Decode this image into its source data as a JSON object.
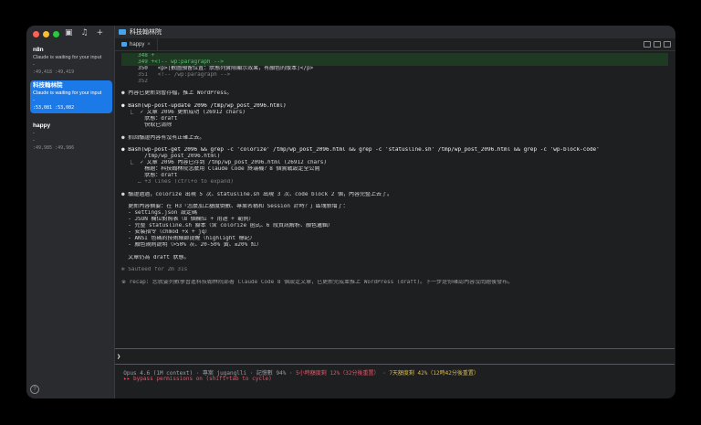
{
  "sidebar": {
    "sessions": [
      {
        "name": "n8n",
        "status": "Claude is waiting for your input",
        "dash": "-",
        "pos": ":49,418 :49,419"
      },
      {
        "name": "科技翰林院",
        "status": "Claude is waiting for your input",
        "dash": "-",
        "pos": ":53,081 :53,082"
      },
      {
        "name": "happy",
        "status": "-",
        "dash": "-",
        "pos": ":49,985 :49,986"
      }
    ],
    "help": "?"
  },
  "window": {
    "title": "科技翰林院"
  },
  "tab": {
    "label": "happy",
    "close": "×"
  },
  "terminal": {
    "lines": [
      {
        "t": "     348 +",
        "c": "diff-add grn"
      },
      {
        "t": "     349 +<!-- wp:paragraph -->",
        "c": "diff-add grn"
      },
      {
        "t": "     350   <p>[數圖預留位置：狀態列實際顯示效果，有顏色的版本]</p>",
        "c": ""
      },
      {
        "t": "     351   <!-- /wp:paragraph -->",
        "c": "dim"
      },
      {
        "t": "     352",
        "c": "dim"
      },
      {
        "t": "",
        "c": ""
      },
      {
        "t": "● 內容已更新到暫存檔，推上 WordPress。",
        "c": ""
      },
      {
        "t": "",
        "c": ""
      },
      {
        "t": "● Bash(wp-post-update 2096 /tmp/wp_post_2096.html)",
        "c": "bash"
      },
      {
        "t": "  ⎿  ✓ 文章 2096 更新成功 (26912 chars)",
        "c": ""
      },
      {
        "t": "       狀態：draft",
        "c": ""
      },
      {
        "t": "       快取已清除",
        "c": ""
      },
      {
        "t": "",
        "c": ""
      },
      {
        "t": "● 抓回驗證內容有沒有正確上去。",
        "c": ""
      },
      {
        "t": "",
        "c": ""
      },
      {
        "t": "● Bash(wp-post-get 2096 && grep -c 'colorize' /tmp/wp_post_2096.html && grep -c 'statusline.sh' /tmp/wp_post_2096.html && grep -c 'wp-block-code'",
        "c": "bash"
      },
      {
        "t": "       /tmp/wp_post_2096.html)",
        "c": ""
      },
      {
        "t": "  ⎿  ✓ 文章 2096 內容已存到 /tmp/wp_post_2096.html (26912 chars)",
        "c": ""
      },
      {
        "t": "       標題：科技翰林院怎麼用 Claude Code 終端機？8 個實戰設定全公開",
        "c": ""
      },
      {
        "t": "       狀態：draft",
        "c": ""
      },
      {
        "t": "     … +3 lines (ctrl+o to expand)",
        "c": "dim"
      },
      {
        "t": "",
        "c": ""
      },
      {
        "t": "● 驗證過過，colorize 出現 5 次、statusline.sh 出現 3 次、code block 2 個，內容完整上去了。",
        "c": "verify"
      },
      {
        "t": "",
        "c": ""
      },
      {
        "t": "  更新內容摘要：在 H3「怎麼加上額度倒數、專案名稱和 Session 計時？」區塊新增了：",
        "c": ""
      },
      {
        "t": "  - settings.json 設定碼",
        "c": "settings"
      },
      {
        "t": "  - JSON 欄位對照表（8 個欄位 + 用途 + 範例）",
        "c": ""
      },
      {
        "t": "  - 完整 statusline.sh 腳本（含 colorize 函式、6 段資訊解析、顏色邏輯）",
        "c": "script"
      },
      {
        "t": "  - 安裝指令（chmod +x + jq）",
        "c": "chmod"
      },
      {
        "t": "  - ANSI 色碼的技術細節提醒（highlight 標記）",
        "c": ""
      },
      {
        "t": "  - 顏色規則說明（>50% 灰、20-50% 黃、≤20% 紅）",
        "c": ""
      },
      {
        "t": "",
        "c": ""
      },
      {
        "t": "  文章仍為 draft 狀態。",
        "c": ""
      },
      {
        "t": "",
        "c": ""
      },
      {
        "t": "✻ Sautéed for 2m 31s",
        "c": "dim"
      },
      {
        "t": "",
        "c": ""
      },
      {
        "t": "※ recap: 您就要列數學習進科技翰林院部署 Claude Code 8 個設定文章，已更新完成並推上 WordPress (draft)。下一步是你確認內容沒問題後發布。",
        "c": "recap"
      }
    ],
    "prompt": "❯",
    "status1a": "  Opus 4.6 (1M context) · 專案 juganglli · 記憶數 94% · ",
    "status1b": "5小時額度剩 12%（32分後重置）",
    "status1c": " · ",
    "status1d": "7天額度剩 42%（12時42分後重置）",
    "status2": "  ▸▸ bypass permissions on (shift+tab to cycle)"
  }
}
